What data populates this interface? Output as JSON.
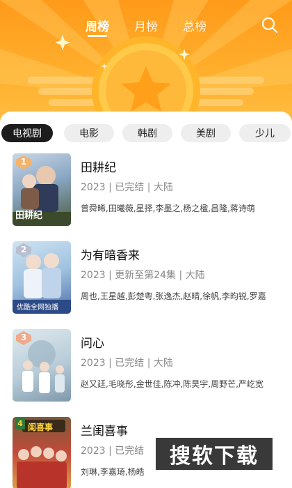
{
  "top_tabs": [
    "周榜",
    "月榜",
    "总榜"
  ],
  "categories": [
    "电视剧",
    "电影",
    "韩剧",
    "美剧",
    "少儿"
  ],
  "items": [
    {
      "rank": "1",
      "title": "田耕纪",
      "meta": "2023 | 已完结 | 大陆",
      "cast": "曾舜晞,田曦薇,星择,李墨之,杨之楹,昌隆,蒋诗萌",
      "poster_text": "田耕纪"
    },
    {
      "rank": "2",
      "title": "为有暗香来",
      "meta": "2023 | 更新至第24集 | 大陆",
      "cast": "周也,王星越,彭楚粤,张逸杰,赵晴,徐帆,李昀锐,罗嘉",
      "poster_text": "优酷全网独播"
    },
    {
      "rank": "3",
      "title": "问心",
      "meta": "2023 | 已完结 | 大陆",
      "cast": "赵又廷,毛晓彤,金世佳,陈冲,陈昊宇,周野芒,严屹宽",
      "poster_text": ""
    },
    {
      "rank": "4",
      "title": "兰闺喜事",
      "meta": "2023 | 已完结",
      "cast": "刘琳,李嘉琦,杨皓",
      "poster_text": "闺喜事"
    }
  ],
  "watermark": "搜软下载",
  "colors": {
    "header_top": "#ff9a1a",
    "header_bottom": "#ffc14a",
    "chip_active": "#1c1c1c",
    "chip_inactive": "#eeeeee",
    "rank_gold": "#f4b26a",
    "rank_silver": "#b7bfd0",
    "rank_bronze": "#f0a98a"
  }
}
